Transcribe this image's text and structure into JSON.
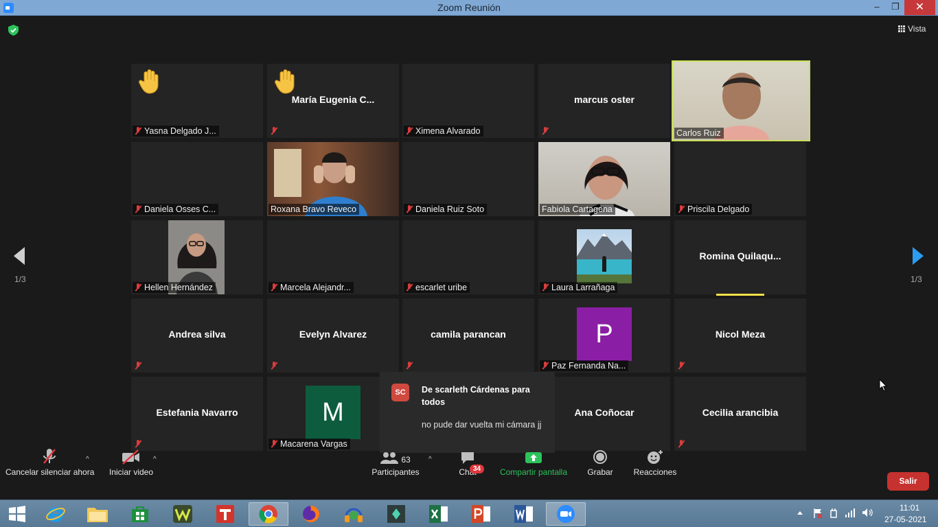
{
  "window": {
    "title": "Zoom Reunión",
    "minimize": "–",
    "maximize": "❐",
    "close": "✕"
  },
  "header": {
    "view_label": "Vista"
  },
  "pagination": {
    "left": "1/3",
    "right": "1/3"
  },
  "tiles": [
    {
      "label": "Yasna Delgado J...",
      "name": "",
      "hand": true,
      "muted": true
    },
    {
      "label": "",
      "name": "María  Eugenia  C...",
      "hand": true,
      "muted": true
    },
    {
      "label": "Ximena Alvarado",
      "name": "",
      "muted": true
    },
    {
      "label": "",
      "name": "marcus oster",
      "muted": true
    },
    {
      "label": "Carlos Ruiz",
      "name": "",
      "video": true,
      "speaking": true
    },
    {
      "label": "Daniela Osses C...",
      "name": "",
      "muted": true
    },
    {
      "label": "Roxana Bravo Reveco",
      "name": "",
      "video": true
    },
    {
      "label": "Daniela Ruiz Soto",
      "name": "",
      "muted": true
    },
    {
      "label": "Fabiola Cartagena",
      "name": "",
      "video": true
    },
    {
      "label": "Priscila Delgado",
      "name": "",
      "muted": true
    },
    {
      "label": "Hellen Hernández",
      "name": "",
      "video": true,
      "muted": true
    },
    {
      "label": "Marcela Alejandr...",
      "name": "",
      "muted": true
    },
    {
      "label": "escarlet  uribe",
      "name": "",
      "muted": true
    },
    {
      "label": "Laura Larrañaga",
      "name": "",
      "photo": true,
      "muted": true
    },
    {
      "label": "",
      "name": "Romina  Quilaqu...",
      "muted": false
    },
    {
      "label": "",
      "name": "Andrea silva",
      "muted": true
    },
    {
      "label": "",
      "name": "Evelyn Alvarez",
      "muted": true
    },
    {
      "label": "",
      "name": "camila parancan",
      "muted": true
    },
    {
      "label": "Paz Fernanda Na...",
      "name": "",
      "avatar": "P",
      "avatar_color": "#8a1fa5",
      "muted": true
    },
    {
      "label": "",
      "name": "Nicol Meza",
      "muted": true
    },
    {
      "label": "",
      "name": "Estefania Navarro",
      "muted": true
    },
    {
      "label": "Macarena Vargas",
      "name": "",
      "avatar": "M",
      "avatar_color": "#0d5c3e",
      "muted": true
    },
    {
      "label": "",
      "name": "",
      "muted": false
    },
    {
      "label": "",
      "name": "Ana Coñocar",
      "muted": false
    },
    {
      "label": "",
      "name": "Cecilia arancibia",
      "muted": true
    }
  ],
  "chat_popup": {
    "initials": "SC",
    "from": "De scarleth Cárdenas para todos",
    "message": "no pude dar vuelta mi cámara jj"
  },
  "toolbar": {
    "unmute_label": "Cancelar silenciar ahora",
    "video_label": "Iniciar video",
    "participants_label": "Participantes",
    "participants_count": "63",
    "chat_label": "Chat",
    "chat_badge": "34",
    "share_label": "Compartir pantalla",
    "record_label": "Grabar",
    "reactions_label": "Reacciones",
    "leave_label": "Salir",
    "caret": "^"
  },
  "taskbar": {
    "apps": [
      "start",
      "internet-explorer",
      "file-explorer",
      "store",
      "winamp",
      "t-app",
      "chrome",
      "firefox",
      "headphones-app",
      "filmora",
      "excel",
      "powerpoint",
      "word",
      "zoom"
    ],
    "time": "11:01",
    "date": "27-05-2021"
  },
  "colors": {
    "accent_green": "#2cc35b",
    "leave_red": "#c6322f",
    "speaking_border": "#c8e05a"
  }
}
